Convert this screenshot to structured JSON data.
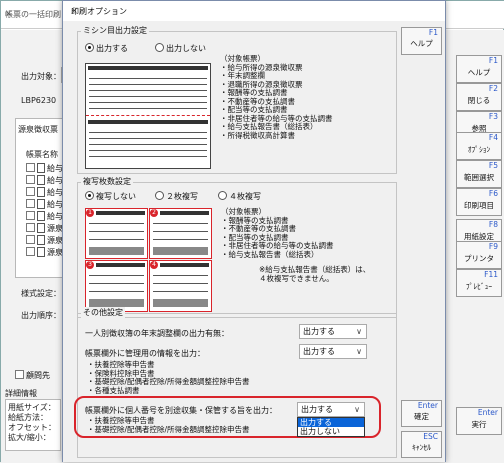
{
  "background": {
    "title": "帳票の一括印刷",
    "close": "×",
    "target_label": "出力対象：",
    "printer": "LBP6230",
    "group_label": "源泉徴収票",
    "list_header": "帳票名称",
    "rows": [
      "給与",
      "給与",
      "給与",
      "給与",
      "給与",
      "源泉",
      "源泉",
      "源泉"
    ],
    "format_label": "様式設定：",
    "order_label": "出力順序：",
    "bottom_check": "顧問先",
    "details_label": "詳細情報",
    "details_lines": [
      "用紙サイズ：",
      "給紙方法：",
      "オフセット：",
      "拡大/縮小："
    ],
    "side_buttons": [
      {
        "key": "F1",
        "label": "ヘルプ"
      },
      {
        "key": "F2",
        "label": "閉じる"
      },
      {
        "key": "F3",
        "label": "参照"
      },
      {
        "key": "F4",
        "label": "ｵﾌﾟｼｮﾝ"
      },
      {
        "key": "F5",
        "label": "範囲選択"
      },
      {
        "key": "F6",
        "label": "印刷項目"
      },
      {
        "key": "F8",
        "label": "用紙設定"
      },
      {
        "key": "F9",
        "label": "プリンタ"
      },
      {
        "key": "F11",
        "label": "ﾌﾟﾚﾋﾞｭｰ"
      },
      {
        "key": "Enter",
        "label": "実行"
      }
    ]
  },
  "dialog": {
    "title": "印刷オプション",
    "close": "×",
    "perforation": {
      "title": "ミシン目出力設定",
      "opt_on": "出力する",
      "opt_off": "出力しない",
      "selected": "出力する",
      "list": "（対象帳票）\n・給与所得の源泉徴収票\n・年末調整欄\n・退職所得の源泉徴収票\n・報酬等の支払調書\n・不動産等の支払調書\n・配当等の支払調書\n・非居住者等の給与等の支払調書\n・給与支払報告書（総括表）\n・所得税徴収高計算書"
    },
    "copies": {
      "title": "複写枚数設定",
      "opts": [
        "複写しない",
        "２枚複写",
        "４枚複写"
      ],
      "selected": "複写しない",
      "list": "（対象帳票）\n・報酬等の支払調書\n・不動産等の支払調書\n・配当等の支払調書\n・非居住者等の給与等の支払調書\n・給与支払報告書（総括表）",
      "note": "※給与支払報告書（総括表）は、\n４枚複写できません。"
    },
    "other": {
      "title": "その他設定",
      "q1": "一人別徴収簿の年末調整欄の出力有無：",
      "q1_value": "出力する",
      "q2": "帳票欄外に管理用の情報を出力：",
      "q2_value": "出力する",
      "q2_list": "・扶養控除等申告書\n・保険料控除申告書\n・基礎控除/配偶者控除/所得金額調整控除申告書\n・各種支払調書",
      "q3": "帳票欄外に個人番号を別途収集・保管する旨を出力：",
      "q3_value": "出力する",
      "q3_list": "・扶養控除等申告書\n・基礎控除/配偶者控除/所得金額調整控除申告書",
      "dropdown_options": [
        "出力する",
        "出力しない"
      ]
    },
    "buttons": [
      {
        "key": "F1",
        "label": "ヘルプ"
      },
      {
        "key": "Enter",
        "label": "確定"
      },
      {
        "key": "ESC",
        "label": "ｷｬﾝｾﾙ"
      }
    ]
  },
  "colors": {
    "highlight": "#d9242b",
    "accent": "#2b58c9",
    "selection": "#0a64d8"
  }
}
